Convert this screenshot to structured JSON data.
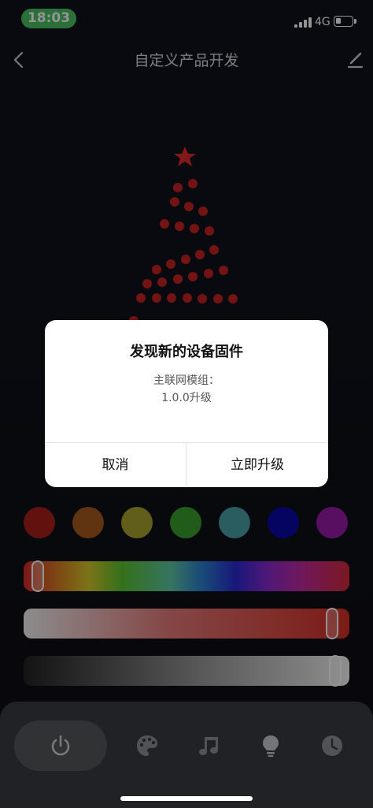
{
  "status_bar": {
    "time": "18:03",
    "network": "4G"
  },
  "nav": {
    "title": "自定义产品开发",
    "back_icon": "chevron-left-icon",
    "edit_icon": "pencil-icon"
  },
  "tree_colors": {
    "star": "#e02a2a",
    "bulb": "#c62222"
  },
  "swatches": [
    {
      "name": "red",
      "color": "#a81f1a"
    },
    {
      "name": "orange",
      "color": "#a55a1d"
    },
    {
      "name": "yellow",
      "color": "#a7a230"
    },
    {
      "name": "green",
      "color": "#3c9f30"
    },
    {
      "name": "teal",
      "color": "#47a0a6"
    },
    {
      "name": "blue",
      "color": "#0a0aa8"
    },
    {
      "name": "purple",
      "color": "#981aa8"
    }
  ],
  "sliders": {
    "hue": 0.02,
    "saturation": 0.97,
    "brightness": 0.98
  },
  "tabs": [
    {
      "name": "power",
      "icon": "power-icon",
      "active": true
    },
    {
      "name": "palette",
      "icon": "palette-icon",
      "active": false
    },
    {
      "name": "music",
      "icon": "music-note-icon",
      "active": false
    },
    {
      "name": "bulb",
      "icon": "bulb-icon",
      "active": false
    },
    {
      "name": "timer",
      "icon": "clock-icon",
      "active": false
    }
  ],
  "dialog": {
    "title": "发现新的设备固件",
    "message_line1": "主联网模组：",
    "message_line2": "1.0.0升级",
    "cancel_label": "取消",
    "upgrade_label": "立即升级"
  }
}
